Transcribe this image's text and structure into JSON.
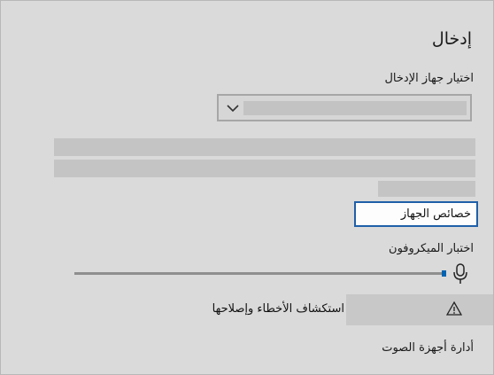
{
  "section": {
    "title": "إدخال"
  },
  "input_device": {
    "label": "اختيار جهاز الإدخال",
    "selected_value": ""
  },
  "device_properties": {
    "label": "خصائص الجهاز"
  },
  "microphone": {
    "label": "اختبار الميكروفون",
    "level": 0.99
  },
  "troubleshoot": {
    "label": "استكشاف الأخطاء وإصلاحها"
  },
  "manage_devices": {
    "label": "أدارة أجهزة الصوت"
  },
  "colors": {
    "accent": "#0063b1",
    "focus_border": "#1f5fa8"
  },
  "icons": {
    "dropdown": "chevron-down-icon",
    "mic": "microphone-icon",
    "warning": "warning-icon"
  }
}
